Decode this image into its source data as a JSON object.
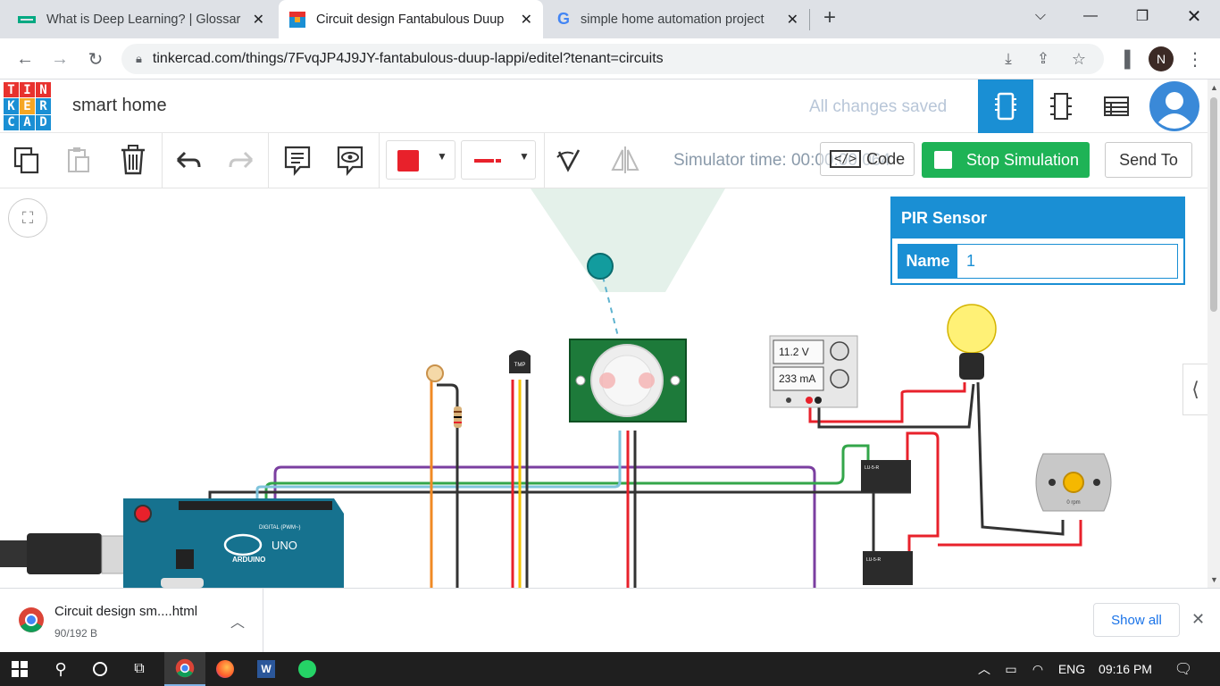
{
  "browser": {
    "tabs": [
      {
        "title": "What is Deep Learning? | Glossar",
        "favicon": "hpe-icon"
      },
      {
        "title": "Circuit design Fantabulous Duup",
        "favicon": "tinkercad-icon",
        "active": true
      },
      {
        "title": "simple home automation project",
        "favicon": "google-icon"
      }
    ],
    "url": "tinkercad.com/things/7FvqJP4J9JY-fantabulous-duup-lappi/editel?tenant=circuits",
    "profile_initial": "N"
  },
  "header": {
    "logo_letters": [
      "T",
      "I",
      "N",
      "K",
      "E",
      "R",
      "C",
      "A",
      "D"
    ],
    "project_name": "smart home",
    "save_status": "All changes saved"
  },
  "toolbar": {
    "simulator_time": "Simulator time: 00:00:00.064",
    "code_label": "Code",
    "stop_label": "Stop Simulation",
    "send_label": "Send To",
    "fill_color": "#e8212b",
    "wire_color": "#e8212b"
  },
  "inspector": {
    "title": "PIR Sensor",
    "name_label": "Name",
    "name_value": "1"
  },
  "components": {
    "power_voltage": "11.2 V",
    "power_current": "233 mA",
    "motor_rpm": "0 rpm",
    "relay_label": "LU-5-R",
    "tmp_label": "TMP",
    "arduino_brand": "ARDUINO",
    "arduino_model": "UNO",
    "arduino_digital": "DIGITAL (PWM~)"
  },
  "download": {
    "filename": "Circuit design sm....html",
    "size": "90/192 B",
    "show_all": "Show all"
  },
  "taskbar": {
    "language": "ENG",
    "time": "09:16 PM"
  },
  "colors": {
    "accent": "#1a8fd4",
    "stop_green": "#1eb356",
    "logo_red": "#e8322e",
    "logo_blue": "#1a8fd4"
  }
}
